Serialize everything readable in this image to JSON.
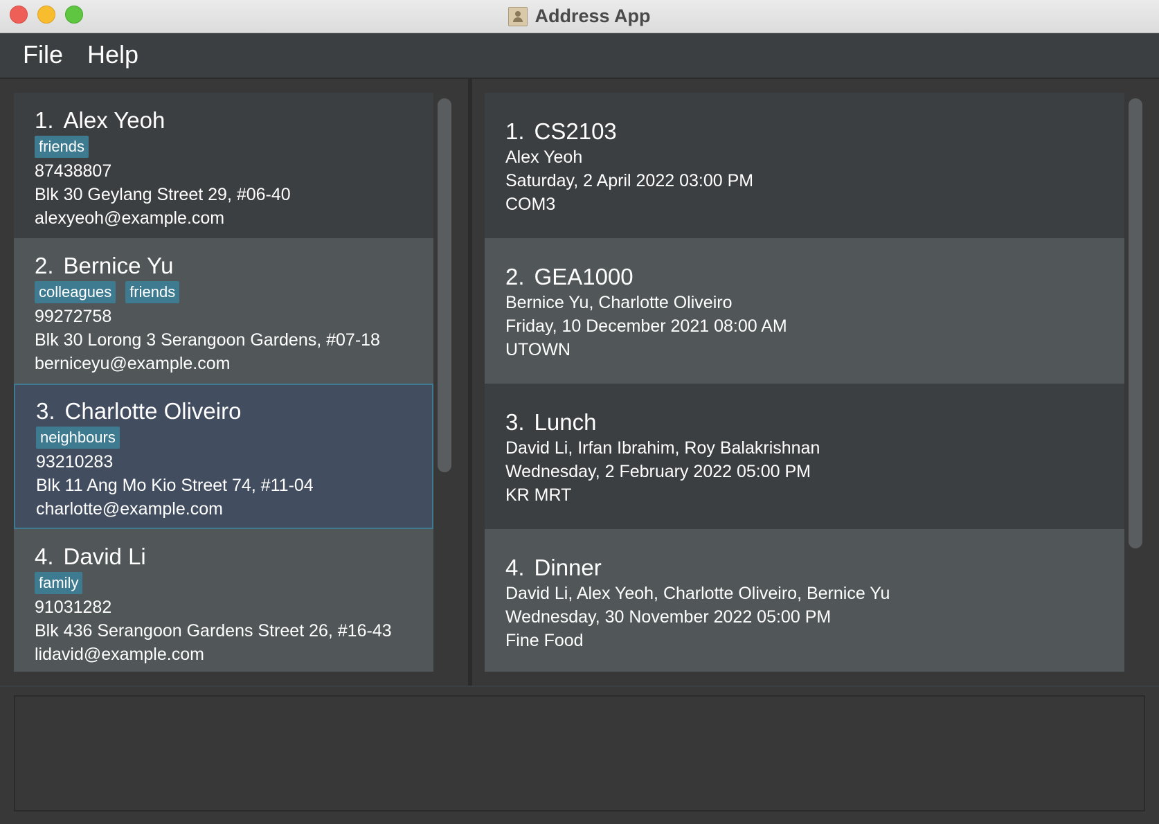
{
  "window": {
    "title": "Address App"
  },
  "menu": {
    "file": "File",
    "help": "Help"
  },
  "persons": [
    {
      "index": "1.",
      "name": "Alex Yeoh",
      "tags": [
        "friends"
      ],
      "phone": "87438807",
      "address": "Blk 30 Geylang Street 29, #06-40",
      "email": "alexyeoh@example.com"
    },
    {
      "index": "2.",
      "name": "Bernice Yu",
      "tags": [
        "colleagues",
        "friends"
      ],
      "phone": "99272758",
      "address": "Blk 30 Lorong 3 Serangoon Gardens, #07-18",
      "email": "berniceyu@example.com"
    },
    {
      "index": "3.",
      "name": "Charlotte Oliveiro",
      "tags": [
        "neighbours"
      ],
      "phone": "93210283",
      "address": "Blk 11 Ang Mo Kio Street 74, #11-04",
      "email": "charlotte@example.com"
    },
    {
      "index": "4.",
      "name": "David Li",
      "tags": [
        "family"
      ],
      "phone": "91031282",
      "address": "Blk 436 Serangoon Gardens Street 26, #16-43",
      "email": "lidavid@example.com"
    }
  ],
  "events": [
    {
      "index": "1.",
      "title": "CS2103",
      "participants": "Alex Yeoh",
      "datetime": "Saturday, 2 April 2022 03:00 PM",
      "location": "COM3"
    },
    {
      "index": "2.",
      "title": "GEA1000",
      "participants": "Bernice Yu, Charlotte Oliveiro",
      "datetime": "Friday, 10 December 2021 08:00 AM",
      "location": "UTOWN"
    },
    {
      "index": "3.",
      "title": "Lunch",
      "participants": "David Li, Irfan Ibrahim, Roy Balakrishnan",
      "datetime": "Wednesday, 2 February 2022 05:00 PM",
      "location": "KR MRT"
    },
    {
      "index": "4.",
      "title": "Dinner",
      "participants": "David Li, Alex Yeoh, Charlotte Oliveiro, Bernice Yu",
      "datetime": "Wednesday, 30 November 2022 05:00 PM",
      "location": "Fine Food"
    }
  ],
  "result_display": {
    "text": ""
  },
  "colors": {
    "tag": "#3e7b91",
    "selected_border": "#3e7b91",
    "selected_bg": "#424d5f"
  }
}
